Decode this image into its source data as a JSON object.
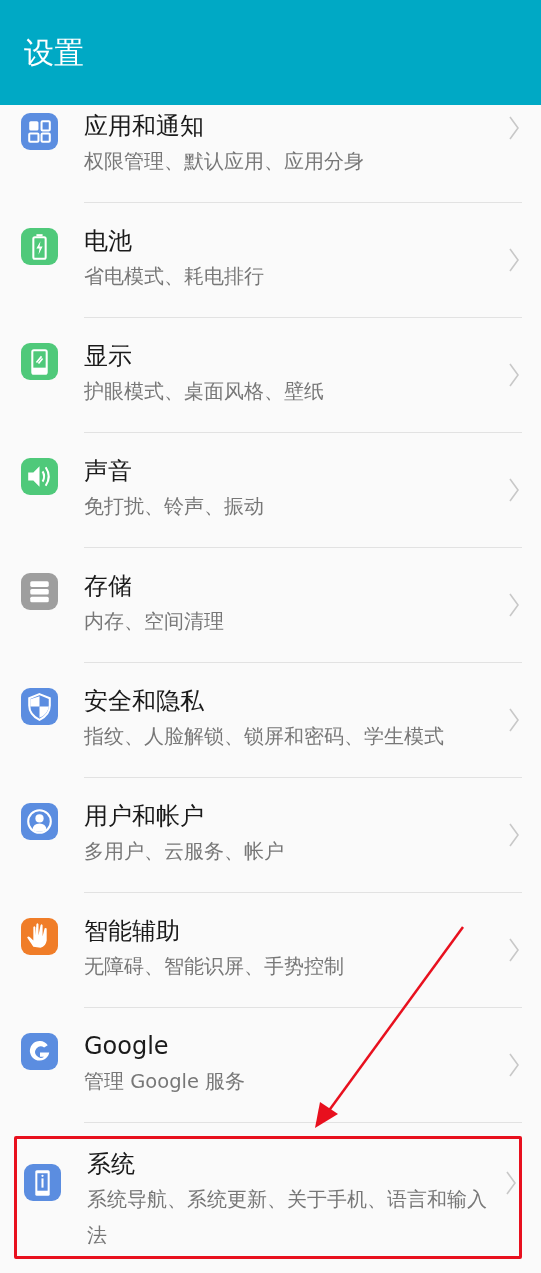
{
  "header": {
    "title": "设置"
  },
  "items": [
    {
      "kind": "apps",
      "color": "#5b8de0",
      "title": "应用和通知",
      "subtitle": "权限管理、默认应用、应用分身",
      "highlighted": false
    },
    {
      "kind": "battery",
      "color": "#4fc97a",
      "title": "电池",
      "subtitle": "省电模式、耗电排行",
      "highlighted": false
    },
    {
      "kind": "display",
      "color": "#4fc97a",
      "title": "显示",
      "subtitle": "护眼模式、桌面风格、壁纸",
      "highlighted": false
    },
    {
      "kind": "sound",
      "color": "#4fc97a",
      "title": "声音",
      "subtitle": "免打扰、铃声、振动",
      "highlighted": false
    },
    {
      "kind": "storage",
      "color": "#9e9e9e",
      "title": "存储",
      "subtitle": "内存、空间清理",
      "highlighted": false
    },
    {
      "kind": "security",
      "color": "#5b8de0",
      "title": "安全和隐私",
      "subtitle": "指纹、人脸解锁、锁屏和密码、学生模式",
      "highlighted": false
    },
    {
      "kind": "user",
      "color": "#5b8de0",
      "title": "用户和帐户",
      "subtitle": "多用户、云服务、帐户",
      "highlighted": false
    },
    {
      "kind": "assist",
      "color": "#f07d28",
      "title": "智能辅助",
      "subtitle": "无障碍、智能识屏、手势控制",
      "highlighted": false
    },
    {
      "kind": "google",
      "color": "#5b8de0",
      "title": "Google",
      "subtitle": "管理 Google 服务",
      "highlighted": false
    },
    {
      "kind": "system",
      "color": "#5b8de0",
      "title": "系统",
      "subtitle": "系统导航、系统更新、关于手机、语言和输入法",
      "highlighted": true
    }
  ]
}
